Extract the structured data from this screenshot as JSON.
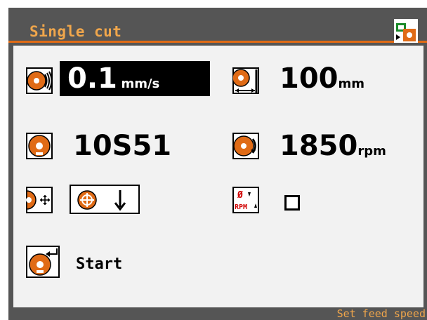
{
  "screen": {
    "title": "Single cut",
    "status": "Set feed speed",
    "accent_color": "#e06b16",
    "title_color": "#f0a64b"
  },
  "params": {
    "feed_speed": {
      "value": "0.1",
      "unit": "mm/s",
      "icon": "feed-speed-icon",
      "selected": true
    },
    "cut_length": {
      "value": "100",
      "unit": "mm",
      "icon": "cut-length-icon"
    },
    "blade": {
      "value": "10S51",
      "icon": "blade-icon"
    },
    "spindle_speed": {
      "value": "1850",
      "unit": "rpm",
      "icon": "spindle-speed-icon"
    },
    "retract": {
      "icon": "retract-icon",
      "box_icons": [
        "crosshair-target-icon",
        "arrow-down-icon"
      ]
    },
    "diameter_rpm": {
      "icon_text_top": "Ø",
      "icon_text_bottom": "RPM",
      "checked": false
    },
    "start": {
      "label": "Start",
      "icon": "blade-return-icon"
    }
  }
}
